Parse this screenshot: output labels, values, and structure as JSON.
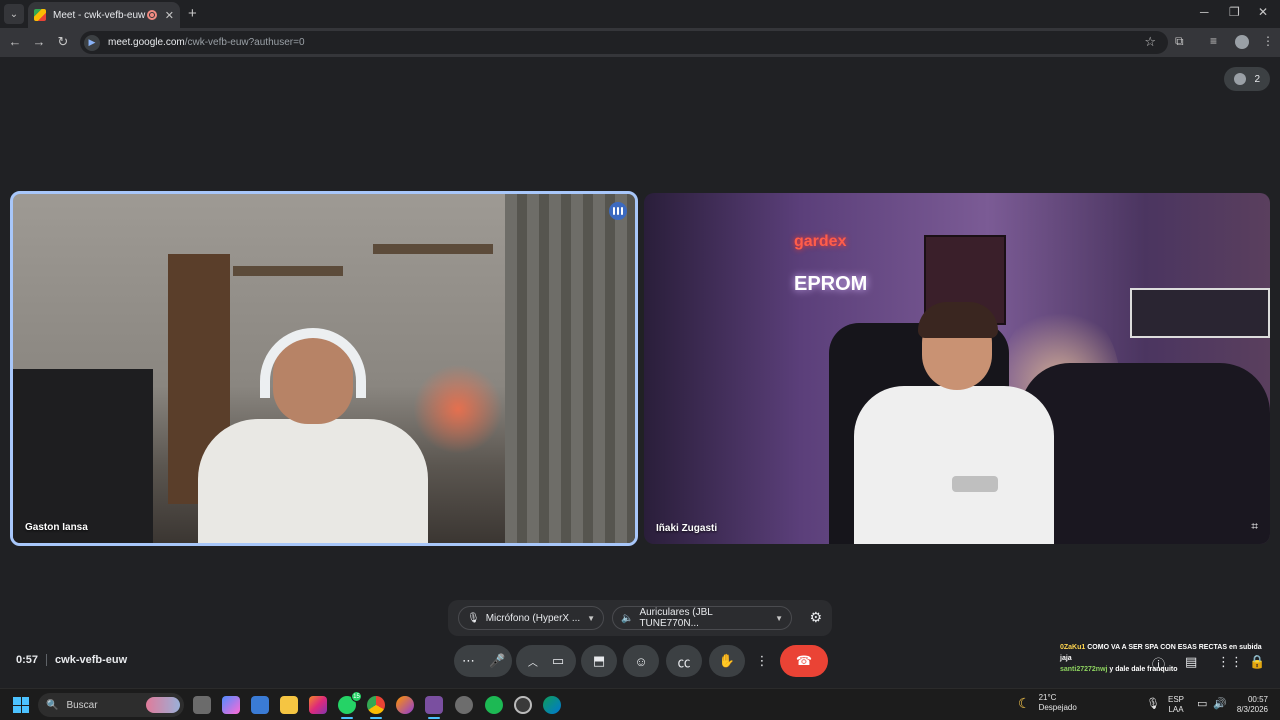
{
  "browser": {
    "tab_title": "Meet - cwk-vefb-euw",
    "tab_close": "✕",
    "new_tab": "+",
    "url_host": "meet.google.com",
    "url_path": "/cwk-vefb-euw?authuser=0"
  },
  "meet": {
    "participants_count": "2",
    "tiles": [
      {
        "name": "Gaston Iansa",
        "speaking": true
      },
      {
        "name": "Iñaki Zugasti",
        "speaking": false
      }
    ],
    "tile_b_neon_top": "gardex",
    "tile_b_neon_bottom": "EPROM",
    "mic_device": "Micrófono (HyperX ...",
    "audio_device": "Auriculares (JBL TUNE770N...",
    "time": "0:57",
    "meeting_code": "cwk-vefb-euw"
  },
  "chat_overlay": [
    {
      "user": "0ZaKu1",
      "text": "COMO VA A SER SPA CON ESAS RECTAS en subida jaja"
    },
    {
      "user": "santi27272nwj",
      "text": "y dale dale franquito"
    }
  ],
  "taskbar": {
    "search_placeholder": "Buscar",
    "whatsapp_badge": "15",
    "temp": "21°C",
    "weather": "Despejado",
    "lang_1": "ESP",
    "lang_2": "LAA",
    "time": "00:57",
    "date": "8/3/2026"
  },
  "colors": {
    "active_border": "#a8c7fa",
    "leave_button": "#ea4335",
    "taskbar_accent": "#4cc2ff"
  }
}
